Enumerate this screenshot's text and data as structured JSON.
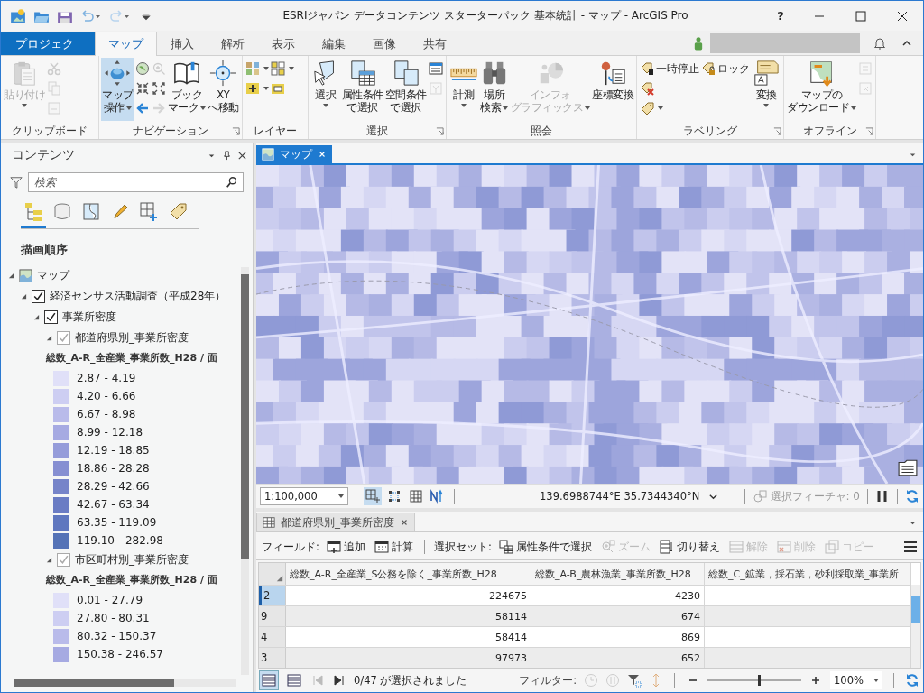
{
  "window": {
    "title": "ESRIジャパン データコンテンツ スターターパック 基本統計 - マップ - ArcGIS Pro",
    "help": "?"
  },
  "ribbon": {
    "tabs": [
      {
        "label": "プロジェクト",
        "kind": "backstage",
        "selected": false
      },
      {
        "label": "マップ",
        "kind": "tab",
        "selected": true
      },
      {
        "label": "挿入",
        "kind": "tab",
        "selected": false
      },
      {
        "label": "解析",
        "kind": "tab",
        "selected": false
      },
      {
        "label": "表示",
        "kind": "tab",
        "selected": false
      },
      {
        "label": "編集",
        "kind": "tab",
        "selected": false
      },
      {
        "label": "画像",
        "kind": "tab",
        "selected": false
      },
      {
        "label": "共有",
        "kind": "tab",
        "selected": false
      }
    ],
    "groups": [
      {
        "label": "クリップボード",
        "items": [
          {
            "kind": "split",
            "lines": [
              "貼り付け"
            ],
            "disabled": true,
            "selected": false
          },
          {
            "kind": "stack",
            "items": [
              {
                "disabled": true
              },
              {
                "disabled": true
              },
              {
                "disabled": true
              }
            ]
          }
        ]
      },
      {
        "label": "ナビゲーション",
        "launcher": true,
        "items": [
          {
            "kind": "large",
            "lines": [
              "マップ",
              "操作"
            ],
            "dropdown": true,
            "disabled": false,
            "selected": true
          },
          {
            "kind": "stack",
            "items": [
              {
                "disabled": false
              },
              {
                "disabled": false
              },
              {
                "disabled": false
              }
            ]
          },
          {
            "kind": "stack",
            "items": [
              {
                "disabled": true
              },
              {
                "disabled": false
              },
              {
                "disabled": true
              }
            ]
          },
          {
            "kind": "large",
            "lines": [
              "ブック",
              "マーク"
            ],
            "dropdown": true,
            "disabled": false,
            "selected": false
          },
          {
            "kind": "large",
            "lines": [
              "XY",
              "へ移動"
            ],
            "disabled": false,
            "selected": false
          }
        ]
      },
      {
        "label": "レイヤー",
        "items": [
          {
            "kind": "stack",
            "items": [
              {
                "disabled": false,
                "dropdown": true
              },
              {
                "disabled": false,
                "dropdown": true
              }
            ]
          },
          {
            "kind": "stack",
            "items": [
              {
                "disabled": false,
                "dropdown": true
              },
              {
                "disabled": false
              }
            ]
          }
        ]
      },
      {
        "label": "選択",
        "launcher": true,
        "items": [
          {
            "kind": "split",
            "lines": [
              "選択"
            ],
            "disabled": false,
            "selected": false
          },
          {
            "kind": "large",
            "lines": [
              "属性条件",
              "で選択"
            ],
            "disabled": false,
            "selected": false
          },
          {
            "kind": "large",
            "lines": [
              "空間条件",
              "で選択"
            ],
            "disabled": false,
            "selected": false
          },
          {
            "kind": "stack",
            "items": [
              {
                "disabled": false
              },
              {
                "disabled": true
              }
            ]
          }
        ]
      },
      {
        "label": "照会",
        "items": [
          {
            "kind": "split",
            "lines": [
              "計測"
            ],
            "disabled": false,
            "selected": false
          },
          {
            "kind": "large",
            "lines": [
              "場所",
              "検索"
            ],
            "dropdown": true,
            "disabled": false,
            "selected": false
          },
          {
            "kind": "large",
            "lines": [
              "インフォ",
              "グラフィックス"
            ],
            "dropdown": true,
            "disabled": true,
            "selected": false
          },
          {
            "kind": "large",
            "lines": [
              "座標変換"
            ],
            "disabled": false,
            "selected": false
          }
        ]
      },
      {
        "label": "ラベリング",
        "launcher": true,
        "items": [
          {
            "kind": "stack",
            "items": [
              {
                "label": "一時停止",
                "disabled": false
              },
              {
                "disabled": false
              },
              {
                "disabled": false,
                "dropdown": true
              }
            ]
          },
          {
            "kind": "stack",
            "items": [
              {
                "label": "ロック",
                "disabled": false
              }
            ]
          },
          {
            "kind": "split",
            "lines": [
              "変換"
            ],
            "disabled": false,
            "selected": false
          }
        ]
      },
      {
        "label": "オフライン",
        "launcher": true,
        "items": [
          {
            "kind": "large",
            "lines": [
              "マップの",
              "ダウンロード"
            ],
            "dropdown": true,
            "disabled": false,
            "selected": false
          },
          {
            "kind": "stack",
            "items": [
              {
                "disabled": true
              },
              {
                "disabled": true
              }
            ]
          }
        ]
      }
    ]
  },
  "contents": {
    "title": "コンテンツ",
    "search": {
      "placeholder": "検索"
    },
    "view_tabs": [
      {
        "selected": true
      },
      {
        "selected": false
      },
      {
        "selected": false
      },
      {
        "selected": false
      },
      {
        "selected": false
      },
      {
        "selected": false
      }
    ],
    "heading": "描画順序",
    "tree": [
      {
        "label": "マップ",
        "kind": "map",
        "expanded": true,
        "children": [
          {
            "label": "経済センサス活動調査（平成28年）",
            "kind": "group",
            "checked": true,
            "expanded": true,
            "children": [
              {
                "label": "事業所密度",
                "kind": "group",
                "checked": true,
                "expanded": true,
                "children": [
                  {
                    "label": "都道府県別_事業所密度",
                    "kind": "layer",
                    "checked": true,
                    "disabled": true,
                    "expanded": true,
                    "field": "総数_A-R_全産業_事業所数_H28 / 面",
                    "classes": [
                      {
                        "label": "2.87 - 4.19",
                        "color": "#e0e0f8"
                      },
                      {
                        "label": "4.20 - 6.66",
                        "color": "#cdcef2"
                      },
                      {
                        "label": "6.67 - 8.98",
                        "color": "#b9bbea"
                      },
                      {
                        "label": "8.99 - 12.18",
                        "color": "#a6aae2"
                      },
                      {
                        "label": "12.19 - 18.85",
                        "color": "#959cda"
                      },
                      {
                        "label": "18.86 - 28.28",
                        "color": "#868fd2"
                      },
                      {
                        "label": "28.29 - 42.66",
                        "color": "#7684c9"
                      },
                      {
                        "label": "42.67 - 63.34",
                        "color": "#6a7cc4"
                      },
                      {
                        "label": "63.35 - 119.09",
                        "color": "#5f77bf"
                      },
                      {
                        "label": "119.10 - 282.98",
                        "color": "#5573b7"
                      }
                    ]
                  },
                  {
                    "label": "市区町村別_事業所密度",
                    "kind": "layer",
                    "checked": true,
                    "disabled": true,
                    "expanded": true,
                    "field": "総数_A-R_全産業_事業所数_H28 / 面",
                    "classes": [
                      {
                        "label": "0.01 - 27.79",
                        "color": "#e0e0f8"
                      },
                      {
                        "label": "27.80 - 80.31",
                        "color": "#cdcef2"
                      },
                      {
                        "label": "80.32 - 150.37",
                        "color": "#b9bbea"
                      },
                      {
                        "label": "150.38 - 246.57",
                        "color": "#a6aae2"
                      }
                    ]
                  }
                ]
              }
            ]
          }
        ]
      }
    ]
  },
  "map_view": {
    "tab": {
      "label": "マップ",
      "selected": true
    },
    "scale": "1:100,000",
    "tools": [
      {
        "selected": true
      },
      {
        "selected": false
      },
      {
        "selected": false
      },
      {
        "selected": false
      }
    ],
    "coordinates": "139.6988744°E 35.7344340°N",
    "selected_features": "選択フィーチャ: 0"
  },
  "table_view": {
    "tab": {
      "label": "都道府県別_事業所密度",
      "selected": true
    },
    "field_label": "フィールド:",
    "field_buttons": [
      {
        "label": "追加",
        "disabled": false
      },
      {
        "label": "計算",
        "disabled": false
      }
    ],
    "selection_label": "選択セット:",
    "selection_buttons": [
      {
        "label": "属性条件で選択",
        "disabled": false
      },
      {
        "label": "ズーム",
        "disabled": true
      },
      {
        "label": "切り替え",
        "disabled": false
      },
      {
        "label": "解除",
        "disabled": true
      },
      {
        "label": "削除",
        "disabled": true
      },
      {
        "label": "コピー",
        "disabled": true
      }
    ],
    "columns": [
      "総数_A-R_全産業_S公務を除く_事業所数_H28",
      "総数_A-B_農林漁業_事業所数_H28",
      "総数_C_鉱業，採石業，砂利採取業_事業所"
    ],
    "rows": [
      {
        "row_header": "2",
        "active": true,
        "cells": [
          "224675",
          "4230"
        ]
      },
      {
        "row_header": "9",
        "active": false,
        "cells": [
          "58114",
          "674"
        ]
      },
      {
        "row_header": "4",
        "active": false,
        "cells": [
          "58414",
          "869"
        ]
      },
      {
        "row_header": "3",
        "active": false,
        "cells": [
          "97973",
          "652"
        ]
      }
    ],
    "view_buttons": [
      {
        "selected": true
      },
      {
        "selected": false
      }
    ],
    "status": "0/47 が選択されました",
    "filter_label": "フィルター:",
    "zoom": {
      "level": 0.55,
      "value": "100%"
    }
  }
}
